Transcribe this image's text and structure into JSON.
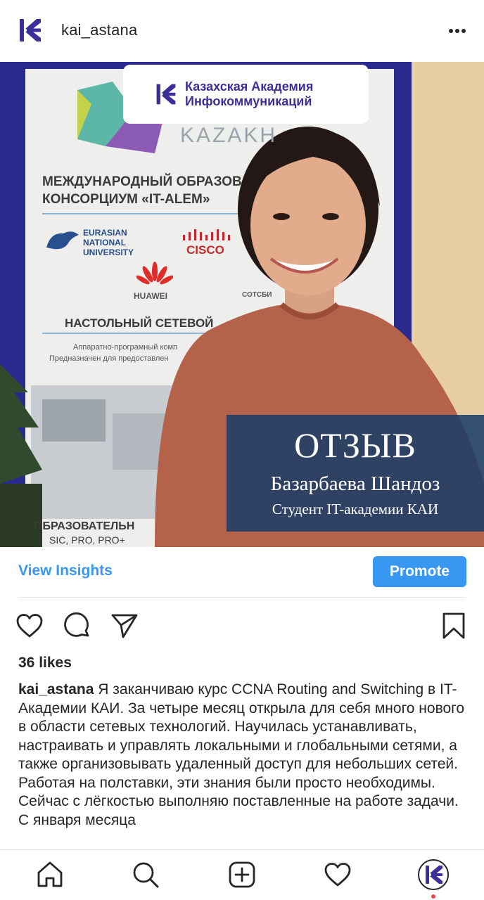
{
  "header": {
    "username": "kai_astana",
    "avatar_icon": "kai-logo-icon",
    "more_icon": "more-horizontal-icon"
  },
  "post_image": {
    "logo_text_line1": "Казахская Академия",
    "logo_text_line2": "Инфокоммуникаций",
    "banner_line1": "МЕЖДУНАРОДНЫЙ ОБРАЗОВ",
    "banner_line2": "КОНСОРЦИУМ «IT-ALEM»",
    "banner_kazakh": "KAZAKH",
    "partner_eurasian_1": "EURASIAN",
    "partner_eurasian_2": "NATIONAL",
    "partner_eurasian_3": "UNIVERSITY",
    "partner_cisco": "CISCO",
    "partner_huawei": "HUAWEI",
    "partner_sotsbi": "СОТСБИ",
    "banner_line3": "НАСТОЛЬНЫЙ СЕТЕВОЙ",
    "banner_small1": "Аппаратно-програмный комп",
    "banner_small2": "Предназначен для предоставлен",
    "banner_bottom1": "ОБРАЗОВАТЕЛЬН",
    "banner_bottom2": "SIC, PRO, PRO+",
    "overlay_title": "ОТЗЫВ",
    "overlay_name": "Базарбаева Шандоз",
    "overlay_role": "Студент IT-академии КАИ"
  },
  "insights": {
    "view_insights_label": "View Insights",
    "promote_label": "Promote"
  },
  "actions": {
    "like_icon": "heart-icon",
    "comment_icon": "comment-icon",
    "share_icon": "send-icon",
    "save_icon": "bookmark-icon"
  },
  "likes_text": "36 likes",
  "caption": {
    "username": "kai_astana",
    "text": " Я заканчиваю курс CCNA Routing and Switching в IT-Академии КАИ. За четыре месяц открыла для себя много нового в области сетевых технологий. Научилась устанавливать, настраивать и управлять локальными и глобальными сетями, а также организовывать удаленный доступ для небольших сетей. Работая на полставки, эти знания были просто необходимы. Сейчас с лёгкостью выполняю поставленные на работе задачи. С января месяца"
  },
  "bottom_nav": {
    "items": [
      "home-icon",
      "search-icon",
      "new-post-icon",
      "activity-heart-icon",
      "profile-avatar-icon"
    ]
  },
  "colors": {
    "accent": "#3897f0",
    "brand": "#3b2f9a",
    "overlay": "#1c3e68",
    "notification": "#ed4956"
  }
}
